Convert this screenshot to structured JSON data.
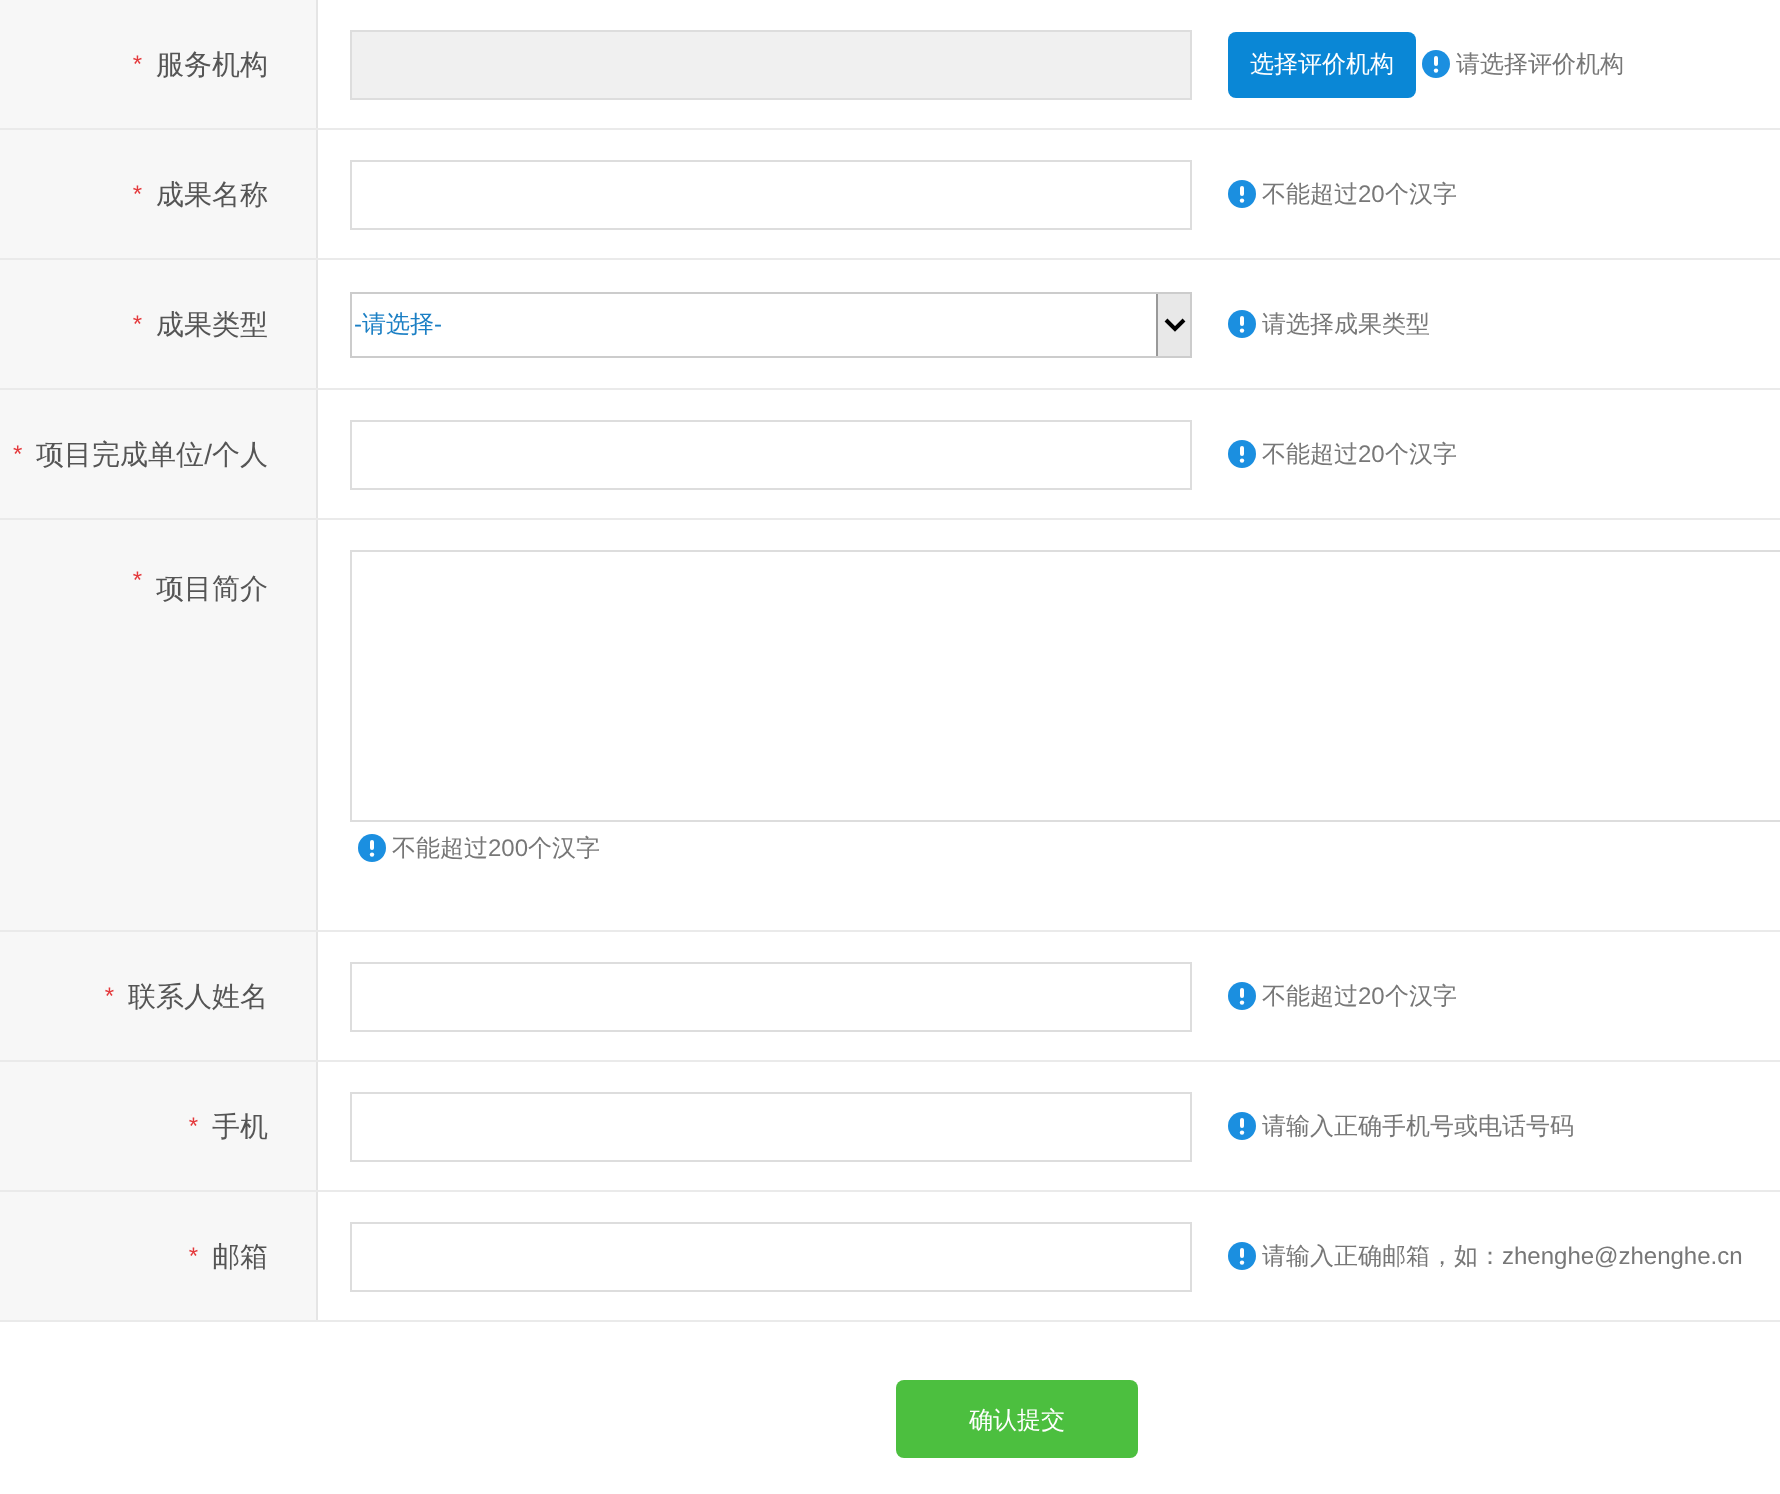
{
  "fields": [
    {
      "kind": "disabled_input",
      "label": "服务机构",
      "required_mark": "*",
      "button": "选择评价机构",
      "hint": "请选择评价机构"
    },
    {
      "kind": "input",
      "label": "成果名称",
      "required_mark": "*",
      "hint": "不能超过20个汉字"
    },
    {
      "kind": "select",
      "label": "成果类型",
      "required_mark": "*",
      "value": "-请选择-",
      "hint": "请选择成果类型"
    },
    {
      "kind": "input",
      "label": "项目完成单位/个人",
      "required_mark": "*",
      "hint": "不能超过20个汉字"
    },
    {
      "kind": "textarea",
      "label": "项目简介",
      "required_mark": "*",
      "hint": "不能超过200个汉字"
    },
    {
      "kind": "input",
      "label": "联系人姓名",
      "required_mark": "*",
      "hint": "不能超过20个汉字"
    },
    {
      "kind": "input",
      "label": "手机",
      "required_mark": "*",
      "hint": "请输入正确手机号或电话号码"
    },
    {
      "kind": "input",
      "label": "邮箱",
      "required_mark": "*",
      "hint": "请输入正确邮箱，如：zhenghe@zhenghe.cn"
    }
  ],
  "submit": "确认提交"
}
